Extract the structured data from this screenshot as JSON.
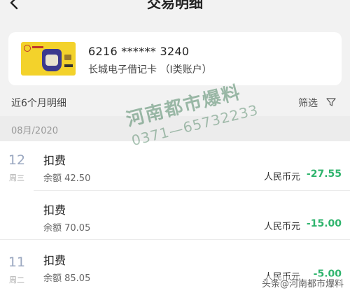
{
  "header": {
    "title": "交易明细",
    "back_icon": "chevron-left-icon"
  },
  "card": {
    "number": "6216 ****** 3240",
    "name": "长城电子借记卡 （I类账户）",
    "image_color": "#f3d22b"
  },
  "filter": {
    "period_label": "近6个月明细",
    "filter_label": "筛选",
    "filter_icon": "funnel-icon"
  },
  "month": {
    "label": "08月/2020"
  },
  "dates": [
    {
      "day": "12",
      "weekday": "周三"
    },
    {
      "day": "11",
      "weekday": "周二"
    }
  ],
  "transactions": [
    {
      "type": "扣费",
      "balance": "余额 42.50",
      "currency": "人民币元",
      "amount": "-27.55"
    },
    {
      "type": "扣费",
      "balance": "余额 70.05",
      "currency": "人民币元",
      "amount": "-15.00"
    },
    {
      "type": "扣费",
      "balance": "余额 85.05",
      "currency": "人民币元",
      "amount": "-5.00"
    }
  ],
  "watermark": {
    "title": "河南都市爆料",
    "phone": "0371—65732233",
    "corner": "头条@河南都市爆料"
  },
  "colors": {
    "amount_negative": "#2fb46d",
    "background": "#f2f2f2",
    "day_number": "#9aa7c0"
  }
}
